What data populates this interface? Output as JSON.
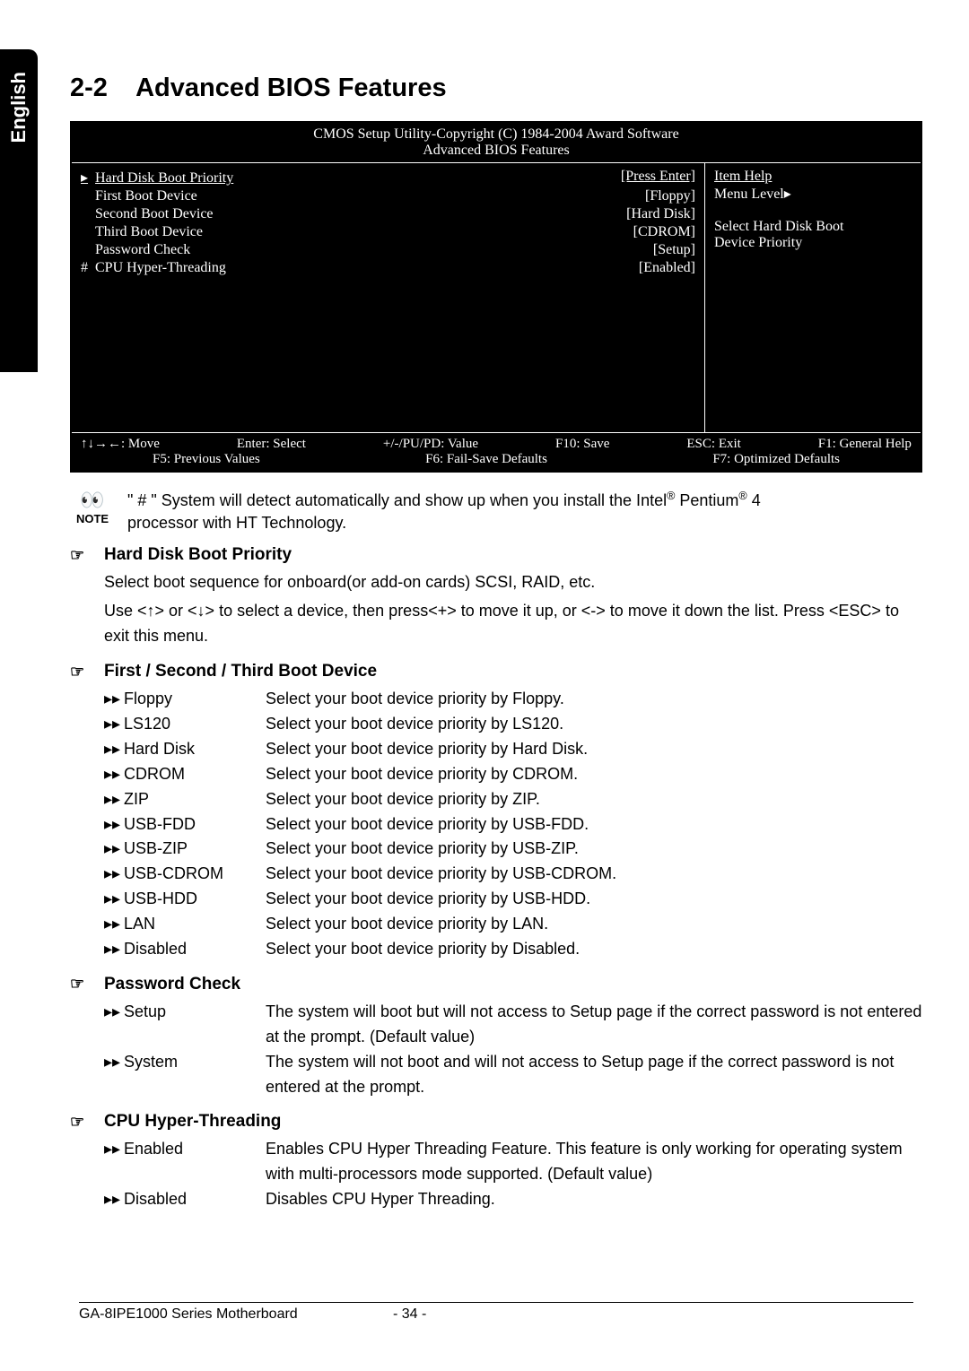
{
  "lang_tab": "English",
  "section_number": "2-2",
  "section_title": "Advanced BIOS Features",
  "bios": {
    "header_line1": "CMOS Setup Utility-Copyright (C) 1984-2004 Award Software",
    "header_line2": "Advanced BIOS Features",
    "items": [
      {
        "prefix": "▸",
        "label": "Hard Disk Boot Priority",
        "value": "[Press Enter]"
      },
      {
        "prefix": "",
        "label": "First Boot Device",
        "value": "[Floppy]"
      },
      {
        "prefix": "",
        "label": "Second Boot Device",
        "value": "[Hard Disk]"
      },
      {
        "prefix": "",
        "label": "Third Boot Device",
        "value": "[CDROM]"
      },
      {
        "prefix": "",
        "label": "Password Check",
        "value": "[Setup]"
      },
      {
        "prefix": "#",
        "label": "CPU Hyper-Threading",
        "value": "[Enabled]"
      }
    ],
    "item_help": {
      "title": "Item Help",
      "menu_level": "Menu Level▸",
      "desc1": "Select Hard Disk Boot",
      "desc2": "Device Priority"
    },
    "footer": {
      "r1c1": "↑↓→←: Move",
      "r1c2": "Enter: Select",
      "r1c3": "+/-/PU/PD: Value",
      "r1c4": "F10: Save",
      "r1c5": "ESC: Exit",
      "r1c6": "F1: General Help",
      "r2c1": "F5: Previous Values",
      "r2c2": "F6: Fail-Save Defaults",
      "r2c3": "F7: Optimized Defaults"
    }
  },
  "note": {
    "icon_label": "NOTE",
    "text_1": "\" # \" System will detect automatically and show up when you install the Intel",
    "reg1": "®",
    "pentium": " Pentium",
    "reg2": "®",
    "four": " 4",
    "text_2": "processor with HT Technology."
  },
  "sections": {
    "hard_disk": {
      "heading": "Hard Disk Boot Priority",
      "desc1": "Select boot sequence for onboard(or add-on cards) SCSI, RAID, etc.",
      "desc2": "Use <↑> or <↓> to select a device, then press<+> to move it up, or <-> to move it down the list. Press <ESC> to exit this menu."
    },
    "boot_device": {
      "heading": "First / Second / Third Boot Device",
      "items": [
        {
          "label": "Floppy",
          "desc": "Select your boot device priority by Floppy."
        },
        {
          "label": "LS120",
          "desc": "Select your boot device priority by LS120."
        },
        {
          "label": "Hard Disk",
          "desc": "Select your boot device priority by Hard Disk."
        },
        {
          "label": "CDROM",
          "desc": "Select your boot device priority by CDROM."
        },
        {
          "label": "ZIP",
          "desc": "Select your boot device priority by ZIP."
        },
        {
          "label": "USB-FDD",
          "desc": "Select your boot device priority by USB-FDD."
        },
        {
          "label": "USB-ZIP",
          "desc": "Select your boot device priority by USB-ZIP."
        },
        {
          "label": "USB-CDROM",
          "desc": "Select your boot device priority by USB-CDROM."
        },
        {
          "label": "USB-HDD",
          "desc": "Select your boot device priority by USB-HDD."
        },
        {
          "label": "LAN",
          "desc": "Select your boot device priority by LAN."
        },
        {
          "label": "Disabled",
          "desc": "Select your boot device priority by Disabled."
        }
      ]
    },
    "password": {
      "heading": "Password Check",
      "items": [
        {
          "label": "Setup",
          "desc": "The system will boot but will not access to Setup page if the correct password is not entered at the prompt. (Default value)"
        },
        {
          "label": "System",
          "desc": "The system will not boot and will not access to Setup page if the correct password is not entered at the prompt."
        }
      ]
    },
    "hyperthreading": {
      "heading": "CPU Hyper-Threading",
      "items": [
        {
          "label": "Enabled",
          "desc": "Enables CPU Hyper Threading Feature. This feature is only working for operating system with multi-processors mode supported. (Default value)"
        },
        {
          "label": "Disabled",
          "desc": "Disables CPU Hyper Threading."
        }
      ]
    }
  },
  "footer": {
    "left": "GA-8IPE1000 Series Motherboard",
    "page": "- 34 -"
  },
  "bullets": {
    "hand": "☞",
    "double_arrow": "▸▸"
  }
}
